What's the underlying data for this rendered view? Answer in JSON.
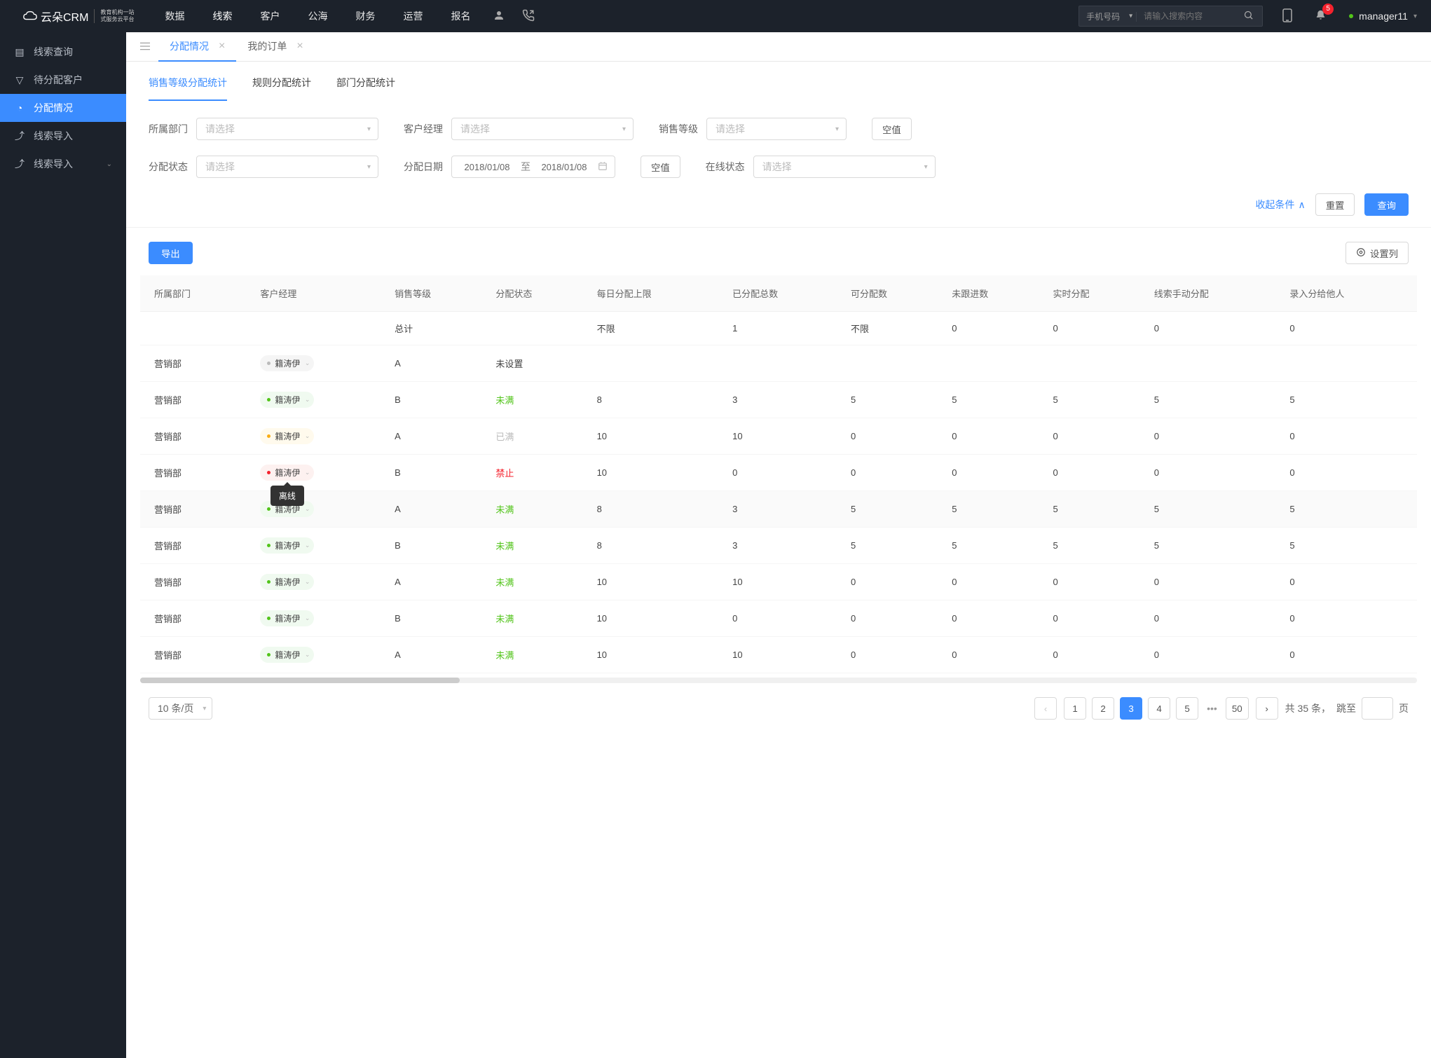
{
  "header": {
    "logo_main": "云朵CRM",
    "logo_sub": "教育机构一站\n式服务云平台",
    "nav": [
      "数据",
      "线索",
      "客户",
      "公海",
      "财务",
      "运营",
      "报名"
    ],
    "nav_active": 1,
    "search_type": "手机号码",
    "search_placeholder": "请输入搜索内容",
    "badge": "5",
    "username": "manager11"
  },
  "sidebar": {
    "items": [
      {
        "label": "线索查询"
      },
      {
        "label": "待分配客户"
      },
      {
        "label": "分配情况"
      },
      {
        "label": "线索导入"
      },
      {
        "label": "线索导入",
        "expandable": true
      }
    ],
    "active": 2
  },
  "tabs": [
    {
      "label": "分配情况",
      "active": true
    },
    {
      "label": "我的订单",
      "active": false
    }
  ],
  "subtabs": [
    "销售等级分配统计",
    "规则分配统计",
    "部门分配统计"
  ],
  "subtab_active": 0,
  "filters": {
    "labels": {
      "dept": "所属部门",
      "mgr": "客户经理",
      "level": "销售等级",
      "status": "分配状态",
      "date": "分配日期",
      "online": "在线状态"
    },
    "placeholder": "请选择",
    "date_from": "2018/01/08",
    "date_sep": "至",
    "date_to": "2018/01/08",
    "empty_btn": "空值",
    "collapse": "收起条件",
    "reset": "重置",
    "search": "查询"
  },
  "toolbar": {
    "export": "导出",
    "settings": "设置列"
  },
  "table": {
    "columns": [
      "所属部门",
      "客户经理",
      "销售等级",
      "分配状态",
      "每日分配上限",
      "已分配总数",
      "可分配数",
      "未跟进数",
      "实时分配",
      "线索手动分配",
      "录入分给他人"
    ],
    "summary": {
      "label": "总计",
      "daily_limit": "不限",
      "assigned": "1",
      "allocatable": "不限",
      "unfollow": "0",
      "realtime": "0",
      "manual": "0",
      "input": "0"
    },
    "rows": [
      {
        "dept": "营销部",
        "mgr": "籍涛伊",
        "dot": "gray",
        "chip": "gray",
        "level": "A",
        "status": "未设置",
        "statusCls": ""
      },
      {
        "dept": "营销部",
        "mgr": "籍涛伊",
        "dot": "green",
        "chip": "green",
        "level": "B",
        "status": "未满",
        "statusCls": "status-green",
        "daily": "8",
        "assigned": "3",
        "alloc": "5",
        "unfollow": "5",
        "realtime": "5",
        "manual": "5",
        "input": "5"
      },
      {
        "dept": "营销部",
        "mgr": "籍涛伊",
        "dot": "yellow",
        "chip": "yellow",
        "level": "A",
        "status": "已满",
        "statusCls": "status-gray",
        "daily": "10",
        "assigned": "10",
        "alloc": "0",
        "unfollow": "0",
        "realtime": "0",
        "manual": "0",
        "input": "0"
      },
      {
        "dept": "营销部",
        "mgr": "籍涛伊",
        "dot": "red",
        "chip": "red",
        "level": "B",
        "status": "禁止",
        "statusCls": "status-red",
        "daily": "10",
        "assigned": "0",
        "alloc": "0",
        "unfollow": "0",
        "realtime": "0",
        "manual": "0",
        "input": "0",
        "tooltip": "离线"
      },
      {
        "dept": "营销部",
        "mgr": "籍涛伊",
        "dot": "green",
        "chip": "green",
        "level": "A",
        "status": "未满",
        "statusCls": "status-green",
        "daily": "8",
        "assigned": "3",
        "alloc": "5",
        "unfollow": "5",
        "realtime": "5",
        "manual": "5",
        "input": "5",
        "hover": true
      },
      {
        "dept": "营销部",
        "mgr": "籍涛伊",
        "dot": "green",
        "chip": "green",
        "level": "B",
        "status": "未满",
        "statusCls": "status-green",
        "daily": "8",
        "assigned": "3",
        "alloc": "5",
        "unfollow": "5",
        "realtime": "5",
        "manual": "5",
        "input": "5"
      },
      {
        "dept": "营销部",
        "mgr": "籍涛伊",
        "dot": "green",
        "chip": "green",
        "level": "A",
        "status": "未满",
        "statusCls": "status-green",
        "daily": "10",
        "assigned": "10",
        "alloc": "0",
        "unfollow": "0",
        "realtime": "0",
        "manual": "0",
        "input": "0"
      },
      {
        "dept": "营销部",
        "mgr": "籍涛伊",
        "dot": "green",
        "chip": "green",
        "level": "B",
        "status": "未满",
        "statusCls": "status-green",
        "daily": "10",
        "assigned": "0",
        "alloc": "0",
        "unfollow": "0",
        "realtime": "0",
        "manual": "0",
        "input": "0"
      },
      {
        "dept": "营销部",
        "mgr": "籍涛伊",
        "dot": "green",
        "chip": "green",
        "level": "A",
        "status": "未满",
        "statusCls": "status-green",
        "daily": "10",
        "assigned": "10",
        "alloc": "0",
        "unfollow": "0",
        "realtime": "0",
        "manual": "0",
        "input": "0"
      }
    ]
  },
  "pager": {
    "page_size": "10 条/页",
    "pages": [
      "1",
      "2",
      "3",
      "4",
      "5"
    ],
    "last": "50",
    "active": "3",
    "total_prefix": "共 ",
    "total": "35",
    "total_suffix": " 条，",
    "jump_prefix": "跳至",
    "jump_suffix": "页"
  }
}
